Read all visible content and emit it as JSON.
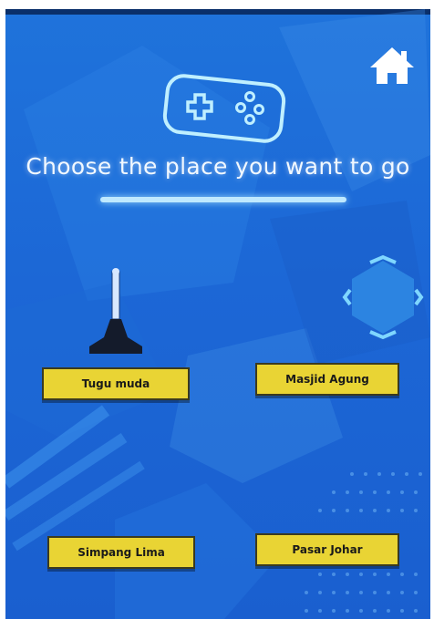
{
  "screen": {
    "title": "Choose the place you want to go",
    "home_icon": "home-icon",
    "gamepad_icon": "gamepad-icon"
  },
  "places": [
    {
      "label": "Tugu muda"
    },
    {
      "label": "Masjid Agung"
    },
    {
      "label": "Simpang Lima"
    },
    {
      "label": "Pasar Johar"
    }
  ],
  "colors": {
    "background": "#1f73db",
    "button_fill": "#e9d434",
    "glow": "#bfe9ff"
  }
}
